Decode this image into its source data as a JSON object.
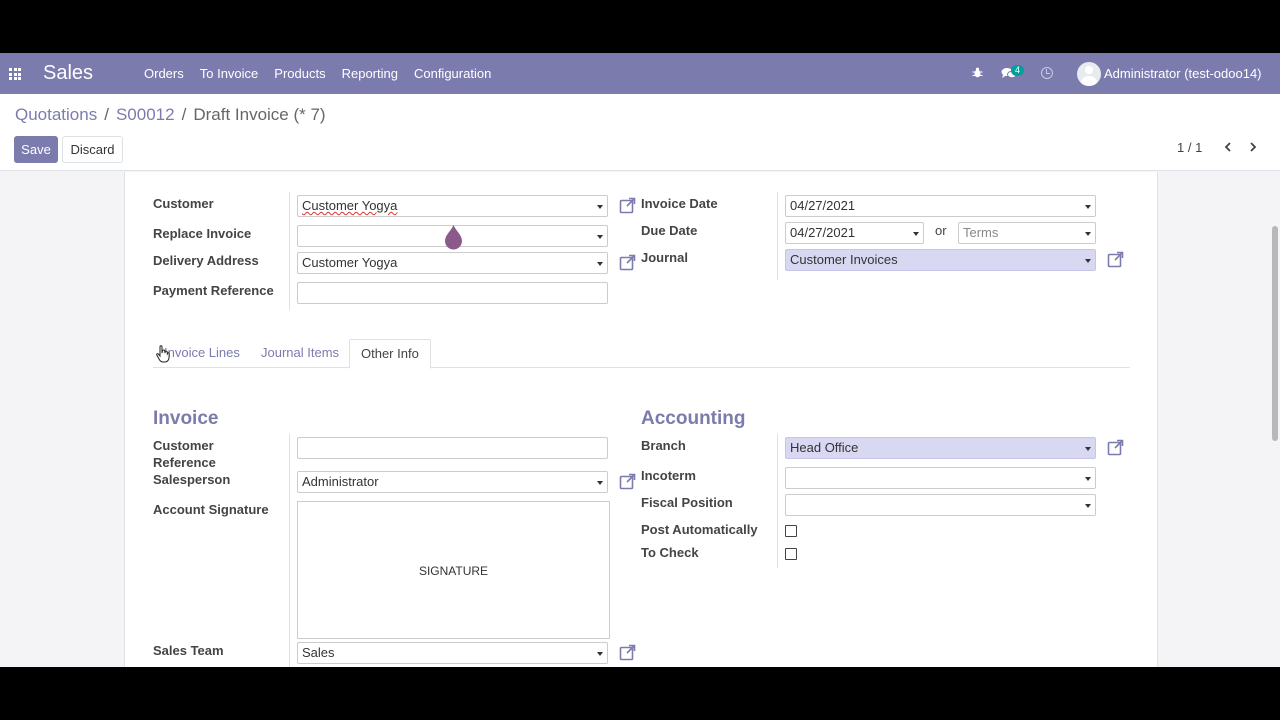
{
  "navbar": {
    "app_name": "Sales",
    "menu": [
      "Orders",
      "To Invoice",
      "Products",
      "Reporting",
      "Configuration"
    ],
    "chat_badge": "4",
    "user": "Administrator (test-odoo14)",
    "color": "#7c7bad"
  },
  "breadcrumb": {
    "items": [
      "Quotations",
      "S00012"
    ],
    "current": "Draft Invoice (* 7)"
  },
  "actions": {
    "save": "Save",
    "discard": "Discard"
  },
  "pager": {
    "text": "1 / 1"
  },
  "form": {
    "customer": {
      "label": "Customer",
      "value": "Customer Yogya"
    },
    "replace_invoice": {
      "label": "Replace Invoice",
      "value": ""
    },
    "delivery_address": {
      "label": "Delivery Address",
      "value": "Customer Yogya"
    },
    "payment_reference": {
      "label": "Payment Reference",
      "value": ""
    },
    "invoice_date": {
      "label": "Invoice Date",
      "value": "04/27/2021"
    },
    "due_date": {
      "label": "Due Date",
      "value": "04/27/2021",
      "or": "or",
      "terms_placeholder": "Terms"
    },
    "journal": {
      "label": "Journal",
      "value": "Customer Invoices"
    }
  },
  "tabs": [
    "Invoice Lines",
    "Journal Items",
    "Other Info"
  ],
  "active_tab": "Other Info",
  "invoice_section": {
    "title": "Invoice",
    "customer_reference": {
      "label_line1": "Customer",
      "label_line2": "Reference",
      "value": ""
    },
    "salesperson": {
      "label": "Salesperson",
      "value": "Administrator"
    },
    "account_signature": {
      "label": "Account Signature",
      "placeholder": "SIGNATURE"
    },
    "sales_team": {
      "label": "Sales Team",
      "value": "Sales"
    }
  },
  "accounting_section": {
    "title": "Accounting",
    "branch": {
      "label": "Branch",
      "value": "Head Office"
    },
    "incoterm": {
      "label": "Incoterm",
      "value": ""
    },
    "fiscal_position": {
      "label": "Fiscal Position",
      "value": ""
    },
    "post_automatically": {
      "label": "Post Automatically",
      "checked": false
    },
    "to_check": {
      "label": "To Check",
      "checked": false
    }
  }
}
